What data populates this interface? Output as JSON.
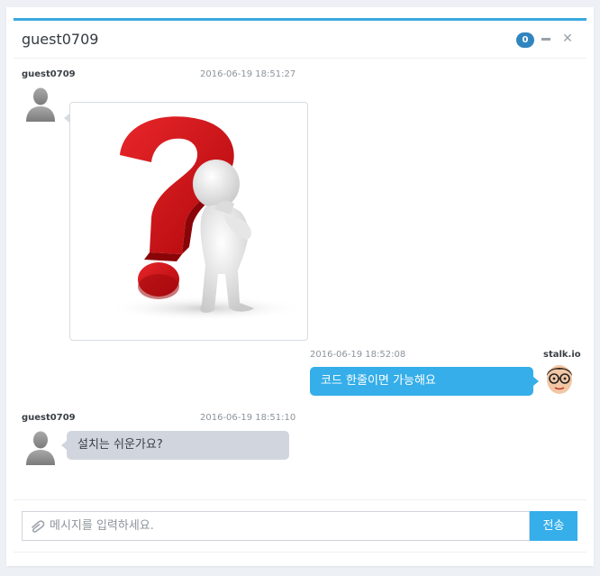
{
  "header": {
    "title": "guest0709",
    "unread_count": "0",
    "minimize_icon": "minus-icon",
    "close_icon": "close-icon",
    "close_glyph": "✕"
  },
  "messages": [
    {
      "sender": "guest0709",
      "time": "2016-06-19 18:51:27",
      "side": "left",
      "type": "image",
      "image": "question-mark-figure"
    },
    {
      "sender": "stalk.io",
      "time": "2016-06-19 18:52:08",
      "side": "right",
      "type": "text",
      "text": "코드 한줄이면 가능해요"
    },
    {
      "sender": "guest0709",
      "time": "2016-06-19 18:51:10",
      "side": "left",
      "type": "text",
      "text": "설치는 쉬운가요?"
    }
  ],
  "composer": {
    "placeholder": "메시지를 입력하세요.",
    "value": "",
    "attach_icon": "paperclip-icon",
    "send_label": "전송"
  },
  "colors": {
    "accent": "#35aee9",
    "header_border": "#3aa9df",
    "badge": "#3185bf",
    "left_bubble": "#d1d6de",
    "question_mark": "#d0181c"
  }
}
